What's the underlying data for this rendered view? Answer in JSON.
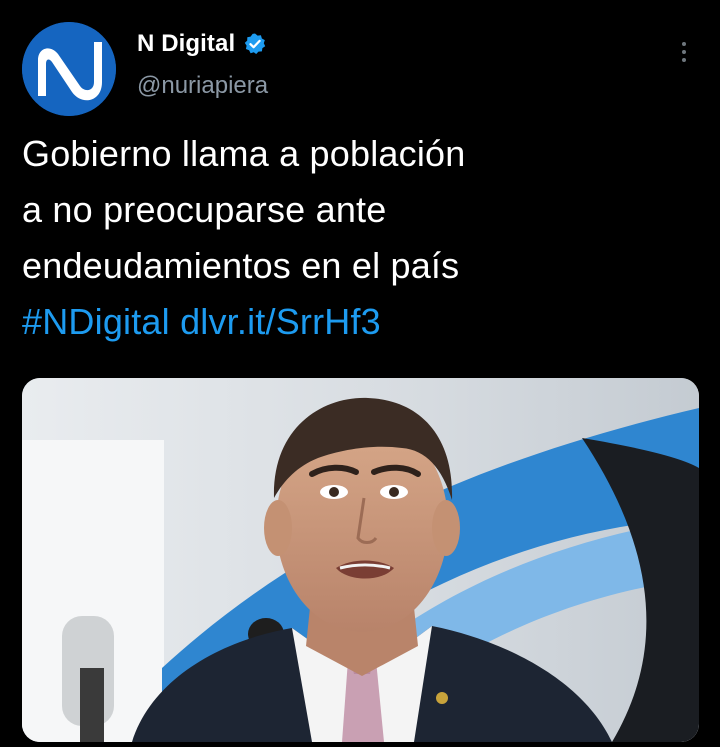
{
  "author": {
    "display_name": "N Digital",
    "handle": "@nuriapiera",
    "avatar_icon": "n-digital-logo-icon",
    "verified_icon": "verified-badge-icon",
    "avatar_color": "#1565c0",
    "verified_color": "#1d9bf0"
  },
  "more_icon": "more-options-icon",
  "tweet": {
    "lines": [
      "Gobierno llama a población",
      "a no preocuparse ante",
      "endeudamientos en el país"
    ],
    "hashtag": "#NDigital",
    "link": "dlvr.it/SrrHf3",
    "link_color": "#1d9bf0"
  },
  "media": {
    "description_icon": "news-photo-speaker-at-microphone"
  }
}
